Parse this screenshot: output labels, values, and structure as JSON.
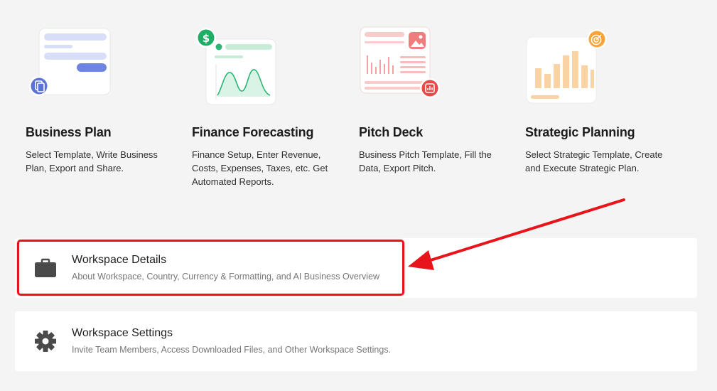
{
  "features": [
    {
      "title": "Business Plan",
      "description": "Select Template, Write Business Plan, Export and Share.",
      "icon": "document-icon"
    },
    {
      "title": "Finance Forecasting",
      "description": "Finance Setup, Enter Revenue, Costs, Expenses, Taxes, etc. Get Automated Reports.",
      "icon": "dollar-icon"
    },
    {
      "title": "Pitch Deck",
      "description": "Business Pitch Template, Fill the Data, Export Pitch.",
      "icon": "chart-icon"
    },
    {
      "title": "Strategic Planning",
      "description": "Select Strategic Template, Create and Execute Strategic Plan.",
      "icon": "target-icon"
    }
  ],
  "workspace": {
    "details": {
      "title": "Workspace Details",
      "subtitle": "About Workspace, Country, Currency & Formatting, and AI Business Overview",
      "icon": "briefcase-icon"
    },
    "settings": {
      "title": "Workspace Settings",
      "subtitle": "Invite Team Members, Access Downloaded Files, and Other Workspace Settings.",
      "icon": "gear-icon"
    }
  },
  "annotation": {
    "color": "#e8141b"
  },
  "colors": {
    "background": "#f4f4f4",
    "card": "#ffffff",
    "business_blue": "#5b73d6",
    "finance_green": "#2bb673",
    "pitch_red": "#ef4f4f",
    "strategy_orange": "#f5a53a"
  }
}
